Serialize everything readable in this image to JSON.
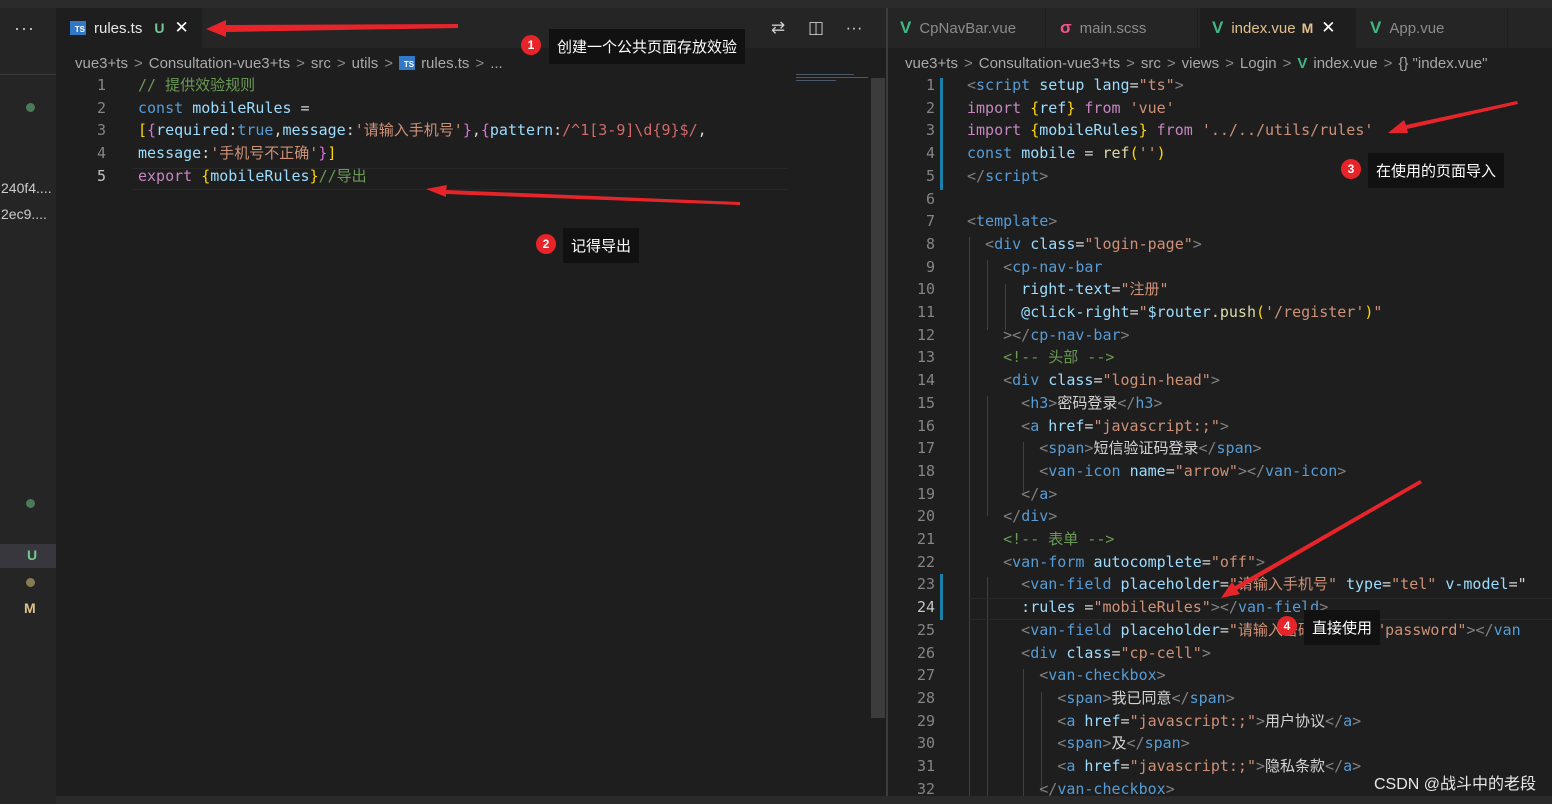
{
  "left_editor": {
    "more_icon": "···",
    "tab": {
      "label": "rules.ts",
      "badge": "U",
      "close": "✕",
      "icon": "ts-file-icon"
    },
    "actions": {
      "compare": "⇄",
      "split": "◫",
      "more": "···"
    },
    "breadcrumb": [
      "vue3+ts",
      "Consultation-vue3+ts",
      "src",
      "utils",
      "rules.ts",
      "..."
    ],
    "line_numbers": [
      "1",
      "2",
      "3",
      "4",
      "5"
    ],
    "lines": [
      [
        [
          "// 提供效验规则",
          "c-com"
        ]
      ],
      [
        [
          "const ",
          "c-key"
        ],
        [
          "mobileRules",
          "c-var"
        ],
        [
          " =",
          "c-txt"
        ]
      ],
      [
        [
          "[",
          "c-br"
        ],
        [
          "{",
          "c-br2"
        ],
        [
          "required",
          "c-var"
        ],
        [
          ":",
          "c-txt"
        ],
        [
          "true",
          "c-key"
        ],
        [
          ",",
          "c-txt"
        ],
        [
          "message",
          "c-var"
        ],
        [
          ":",
          "c-txt"
        ],
        [
          "'请输入手机号'",
          "c-str"
        ],
        [
          "}",
          "c-br2"
        ],
        [
          ",",
          "c-txt"
        ],
        [
          "{",
          "c-br2"
        ],
        [
          "pattern",
          "c-var"
        ],
        [
          ":",
          "c-txt"
        ],
        [
          "/^1[3-9]\\d{9}$/",
          "c-rx"
        ],
        [
          ",",
          "c-txt"
        ]
      ],
      [
        [
          "message",
          "c-var"
        ],
        [
          ":",
          "c-txt"
        ],
        [
          "'手机号不正确'",
          "c-str"
        ],
        [
          "}",
          "c-br2"
        ],
        [
          "]",
          "c-br"
        ]
      ],
      [
        [
          "export ",
          "c-ctl"
        ],
        [
          "{",
          "c-br"
        ],
        [
          "mobileRules",
          "c-var"
        ],
        [
          "}",
          "c-br"
        ],
        [
          "//导出",
          "c-com"
        ]
      ]
    ]
  },
  "sidebar": {
    "hash_1": "240f4....",
    "hash_2": "2ec9....",
    "status_u": "U",
    "status_m": "M"
  },
  "right_editor": {
    "tabs": [
      {
        "label": "CpNavBar.vue",
        "icon": "V",
        "icon_color": "#41b883",
        "active": false
      },
      {
        "label": "main.scss",
        "icon": "σ",
        "icon_color": "#f55385",
        "active": false
      },
      {
        "label": "index.vue",
        "icon": "V",
        "icon_color": "#41b883",
        "active": true,
        "badge": "M",
        "close": "✕"
      },
      {
        "label": "App.vue",
        "icon": "V",
        "icon_color": "#41b883",
        "active": false
      }
    ],
    "breadcrumb": [
      "vue3+ts",
      "Consultation-vue3+ts",
      "src",
      "views",
      "Login",
      "index.vue",
      "{} \"index.vue\""
    ],
    "line_numbers": [
      "1",
      "2",
      "3",
      "4",
      "5",
      "6",
      "7",
      "8",
      "9",
      "10",
      "11",
      "12",
      "13",
      "14",
      "15",
      "16",
      "17",
      "18",
      "19",
      "20",
      "21",
      "22",
      "23",
      "24",
      "25",
      "26",
      "27",
      "28",
      "29",
      "30",
      "31",
      "32"
    ],
    "lines": [
      [
        [
          "<",
          "c-pun"
        ],
        [
          "script ",
          "c-tag"
        ],
        [
          "setup ",
          "c-var"
        ],
        [
          "lang",
          "c-var"
        ],
        [
          "=",
          "c-txt"
        ],
        [
          "\"ts\"",
          "c-str"
        ],
        [
          ">",
          "c-pun"
        ]
      ],
      [
        [
          "import ",
          "c-ctl"
        ],
        [
          "{",
          "c-br"
        ],
        [
          "ref",
          "c-var"
        ],
        [
          "} ",
          "c-br"
        ],
        [
          "from ",
          "c-ctl"
        ],
        [
          "'vue'",
          "c-str"
        ]
      ],
      [
        [
          "import ",
          "c-ctl"
        ],
        [
          "{",
          "c-br"
        ],
        [
          "mobileRules",
          "c-var"
        ],
        [
          "} ",
          "c-br"
        ],
        [
          "from ",
          "c-ctl"
        ],
        [
          "'../../utils/rules'",
          "c-str"
        ]
      ],
      [
        [
          "const ",
          "c-key"
        ],
        [
          "mobile ",
          "c-var"
        ],
        [
          "= ",
          "c-txt"
        ],
        [
          "ref",
          "c-fn"
        ],
        [
          "(",
          "c-br"
        ],
        [
          "''",
          "c-str"
        ],
        [
          ")",
          "c-br"
        ]
      ],
      [
        [
          "</",
          "c-pun"
        ],
        [
          "script",
          "c-tag"
        ],
        [
          ">",
          "c-pun"
        ]
      ],
      [],
      [
        [
          "<",
          "c-pun"
        ],
        [
          "template",
          "c-tag"
        ],
        [
          ">",
          "c-pun"
        ]
      ],
      [
        [
          "  <",
          "c-pun"
        ],
        [
          "div ",
          "c-tag"
        ],
        [
          "class",
          "c-var"
        ],
        [
          "=",
          "c-txt"
        ],
        [
          "\"login-page\"",
          "c-str"
        ],
        [
          ">",
          "c-pun"
        ]
      ],
      [
        [
          "    <",
          "c-pun"
        ],
        [
          "cp-nav-bar",
          "c-tag"
        ]
      ],
      [
        [
          "      right-text",
          "c-var"
        ],
        [
          "=",
          "c-txt"
        ],
        [
          "\"注册\"",
          "c-str"
        ]
      ],
      [
        [
          "      @click-right",
          "c-var"
        ],
        [
          "=",
          "c-txt"
        ],
        [
          "\"",
          "c-str"
        ],
        [
          "$router",
          "c-var"
        ],
        [
          ".",
          "c-txt"
        ],
        [
          "push",
          "c-fn"
        ],
        [
          "(",
          "c-br"
        ],
        [
          "'/register'",
          "c-str"
        ],
        [
          ")",
          "c-br"
        ],
        [
          "\"",
          "c-str"
        ]
      ],
      [
        [
          "    ></",
          "c-pun"
        ],
        [
          "cp-nav-bar",
          "c-tag"
        ],
        [
          ">",
          "c-pun"
        ]
      ],
      [
        [
          "    <!-- 头部 -->",
          "c-com"
        ]
      ],
      [
        [
          "    <",
          "c-pun"
        ],
        [
          "div ",
          "c-tag"
        ],
        [
          "class",
          "c-var"
        ],
        [
          "=",
          "c-txt"
        ],
        [
          "\"login-head\"",
          "c-str"
        ],
        [
          ">",
          "c-pun"
        ]
      ],
      [
        [
          "      <",
          "c-pun"
        ],
        [
          "h3",
          "c-tag"
        ],
        [
          ">",
          "c-pun"
        ],
        [
          "密码登录",
          "c-txt"
        ],
        [
          "</",
          "c-pun"
        ],
        [
          "h3",
          "c-tag"
        ],
        [
          ">",
          "c-pun"
        ]
      ],
      [
        [
          "      <",
          "c-pun"
        ],
        [
          "a ",
          "c-tag"
        ],
        [
          "href",
          "c-var"
        ],
        [
          "=",
          "c-txt"
        ],
        [
          "\"javascript:;\"",
          "c-str"
        ],
        [
          ">",
          "c-pun"
        ]
      ],
      [
        [
          "        <",
          "c-pun"
        ],
        [
          "span",
          "c-tag"
        ],
        [
          ">",
          "c-pun"
        ],
        [
          "短信验证码登录",
          "c-txt"
        ],
        [
          "</",
          "c-pun"
        ],
        [
          "span",
          "c-tag"
        ],
        [
          ">",
          "c-pun"
        ]
      ],
      [
        [
          "        <",
          "c-pun"
        ],
        [
          "van-icon ",
          "c-tag"
        ],
        [
          "name",
          "c-var"
        ],
        [
          "=",
          "c-txt"
        ],
        [
          "\"arrow\"",
          "c-str"
        ],
        [
          "></",
          "c-pun"
        ],
        [
          "van-icon",
          "c-tag"
        ],
        [
          ">",
          "c-pun"
        ]
      ],
      [
        [
          "      </",
          "c-pun"
        ],
        [
          "a",
          "c-tag"
        ],
        [
          ">",
          "c-pun"
        ]
      ],
      [
        [
          "    </",
          "c-pun"
        ],
        [
          "div",
          "c-tag"
        ],
        [
          ">",
          "c-pun"
        ]
      ],
      [
        [
          "    <!-- 表单 -->",
          "c-com"
        ]
      ],
      [
        [
          "    <",
          "c-pun"
        ],
        [
          "van-form ",
          "c-tag"
        ],
        [
          "autocomplete",
          "c-var"
        ],
        [
          "=",
          "c-txt"
        ],
        [
          "\"off\"",
          "c-str"
        ],
        [
          ">",
          "c-pun"
        ]
      ],
      [
        [
          "      <",
          "c-pun"
        ],
        [
          "van-field ",
          "c-tag"
        ],
        [
          "placeholder",
          "c-var"
        ],
        [
          "=",
          "c-txt"
        ],
        [
          "\"请输入手机号\" ",
          "c-str"
        ],
        [
          "type",
          "c-var"
        ],
        [
          "=",
          "c-txt"
        ],
        [
          "\"tel\" ",
          "c-str"
        ],
        [
          "v-model",
          "c-var"
        ],
        [
          "=\"",
          "c-txt"
        ]
      ],
      [
        [
          "      :rules ",
          "c-var"
        ],
        [
          "=",
          "c-txt"
        ],
        [
          "\"mobileRules\"",
          "c-str"
        ],
        [
          "></",
          "c-pun"
        ],
        [
          "van-field",
          "c-tag"
        ],
        [
          ">",
          "c-pun"
        ]
      ],
      [
        [
          "      <",
          "c-pun"
        ],
        [
          "van-field ",
          "c-tag"
        ],
        [
          "placeholder",
          "c-var"
        ],
        [
          "=",
          "c-txt"
        ],
        [
          "\"请输入密码\" ",
          "c-str"
        ],
        [
          "type",
          "c-var"
        ],
        [
          "=",
          "c-txt"
        ],
        [
          "\"password\"",
          "c-str"
        ],
        [
          "></",
          "c-pun"
        ],
        [
          "van",
          "c-tag"
        ]
      ],
      [
        [
          "      <",
          "c-pun"
        ],
        [
          "div ",
          "c-tag"
        ],
        [
          "class",
          "c-var"
        ],
        [
          "=",
          "c-txt"
        ],
        [
          "\"cp-cell\"",
          "c-str"
        ],
        [
          ">",
          "c-pun"
        ]
      ],
      [
        [
          "        <",
          "c-pun"
        ],
        [
          "van-checkbox",
          "c-tag"
        ],
        [
          ">",
          "c-pun"
        ]
      ],
      [
        [
          "          <",
          "c-pun"
        ],
        [
          "span",
          "c-tag"
        ],
        [
          ">",
          "c-pun"
        ],
        [
          "我已同意",
          "c-txt"
        ],
        [
          "</",
          "c-pun"
        ],
        [
          "span",
          "c-tag"
        ],
        [
          ">",
          "c-pun"
        ]
      ],
      [
        [
          "          <",
          "c-pun"
        ],
        [
          "a ",
          "c-tag"
        ],
        [
          "href",
          "c-var"
        ],
        [
          "=",
          "c-txt"
        ],
        [
          "\"javascript:;\"",
          "c-str"
        ],
        [
          ">",
          "c-pun"
        ],
        [
          "用户协议",
          "c-txt"
        ],
        [
          "</",
          "c-pun"
        ],
        [
          "a",
          "c-tag"
        ],
        [
          ">",
          "c-pun"
        ]
      ],
      [
        [
          "          <",
          "c-pun"
        ],
        [
          "span",
          "c-tag"
        ],
        [
          ">",
          "c-pun"
        ],
        [
          "及",
          "c-txt"
        ],
        [
          "</",
          "c-pun"
        ],
        [
          "span",
          "c-tag"
        ],
        [
          ">",
          "c-pun"
        ]
      ],
      [
        [
          "          <",
          "c-pun"
        ],
        [
          "a ",
          "c-tag"
        ],
        [
          "href",
          "c-var"
        ],
        [
          "=",
          "c-txt"
        ],
        [
          "\"javascript:;\"",
          "c-str"
        ],
        [
          ">",
          "c-pun"
        ],
        [
          "隐私条款",
          "c-txt"
        ],
        [
          "</",
          "c-pun"
        ],
        [
          "a",
          "c-tag"
        ],
        [
          ">",
          "c-pun"
        ]
      ],
      [
        [
          "        </",
          "c-pun"
        ],
        [
          "van-checkbox",
          "c-tag"
        ],
        [
          ">",
          "c-pun"
        ]
      ]
    ]
  },
  "annotations": [
    {
      "num": "1",
      "label": "创建一个公共页面存放效验"
    },
    {
      "num": "2",
      "label": "记得导出"
    },
    {
      "num": "3",
      "label": "在使用的页面导入"
    },
    {
      "num": "4",
      "label": "直接使用"
    }
  ],
  "watermark": "CSDN @战斗中的老段",
  "colors": {
    "annotation_red": "#e8242b",
    "vue_green": "#41b883",
    "scss_pink": "#f55385",
    "untracked_green": "#73c991",
    "modified_yellow": "#e2c08d"
  }
}
